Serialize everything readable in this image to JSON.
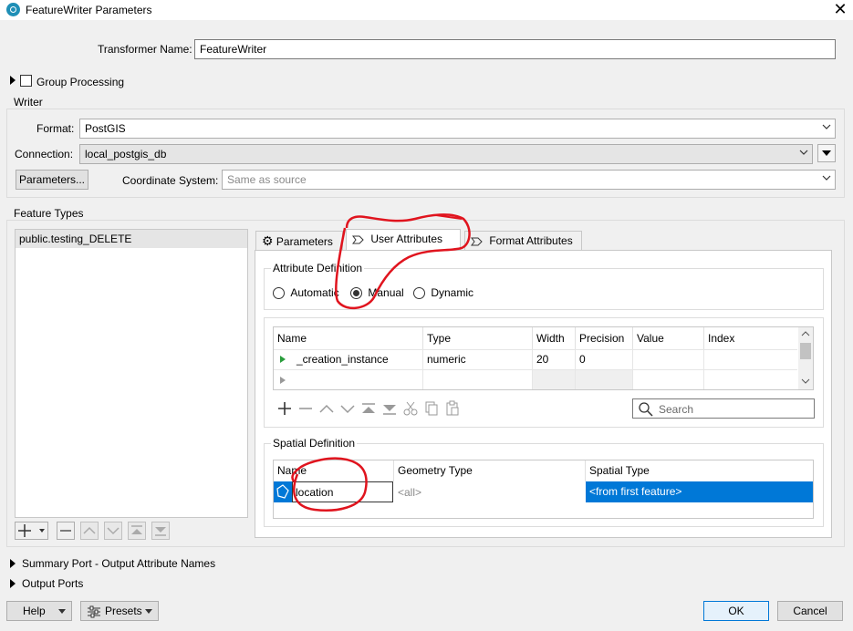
{
  "window": {
    "title": "FeatureWriter Parameters"
  },
  "transformer_name": {
    "label": "Transformer Name:",
    "value": "FeatureWriter"
  },
  "group_processing": {
    "label": "Group Processing"
  },
  "writer": {
    "section_label": "Writer",
    "format_label": "Format:",
    "format_value": "PostGIS",
    "connection_label": "Connection:",
    "connection_value": "local_postgis_db",
    "parameters_button": "Parameters...",
    "coord_label": "Coordinate System:",
    "coord_placeholder": "Same as source"
  },
  "feature_types": {
    "section_label": "Feature Types",
    "items": [
      "public.testing_DELETE"
    ]
  },
  "tabs": [
    "Parameters",
    "User Attributes",
    "Format Attributes"
  ],
  "attribute_definition": {
    "label": "Attribute Definition",
    "options": [
      "Automatic",
      "Manual",
      "Dynamic"
    ],
    "selected": "Manual"
  },
  "attr_table": {
    "columns": [
      "Name",
      "Type",
      "Width",
      "Precision",
      "Value",
      "Index"
    ],
    "rows": [
      {
        "name": "_creation_instance",
        "type": "numeric",
        "width": "20",
        "precision": "0",
        "value": "",
        "index": ""
      }
    ]
  },
  "search": {
    "placeholder": "Search"
  },
  "spatial_definition": {
    "label": "Spatial Definition",
    "columns": [
      "Name",
      "Geometry Type",
      "Spatial Type"
    ],
    "row": {
      "name": "location",
      "geometry_type": "<all>",
      "spatial_type": "<from first feature>"
    }
  },
  "collapsibles": [
    "Summary Port - Output Attribute Names",
    "Output Ports"
  ],
  "footer": {
    "help": "Help",
    "presets": "Presets",
    "ok": "OK",
    "cancel": "Cancel"
  },
  "colors": {
    "accent": "#0078d7",
    "annotation": "#e0141e",
    "selection": "#0078d7"
  }
}
